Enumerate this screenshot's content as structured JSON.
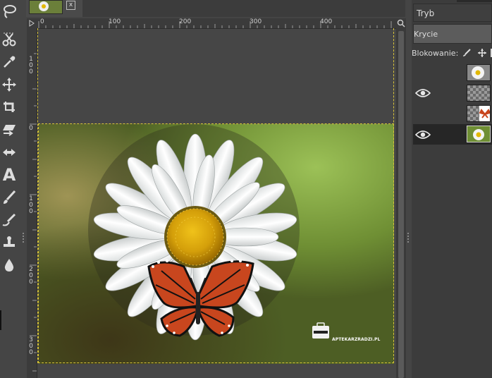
{
  "toolbox": {
    "tools": [
      {
        "name": "free-select",
        "icon": "lasso-icon"
      },
      {
        "name": "scissors-select",
        "icon": "scissors-icon"
      },
      {
        "name": "color-picker",
        "icon": "eyedropper-icon"
      },
      {
        "name": "move",
        "icon": "move-icon"
      },
      {
        "name": "crop",
        "icon": "crop-icon"
      },
      {
        "name": "shear",
        "icon": "shear-icon"
      },
      {
        "name": "flip",
        "icon": "flip-icon"
      },
      {
        "name": "text",
        "icon": "text-icon",
        "glyph": "A"
      },
      {
        "name": "paintbrush",
        "icon": "paintbrush-icon"
      },
      {
        "name": "smudge",
        "icon": "smudge-icon"
      },
      {
        "name": "clone",
        "icon": "clone-stamp-icon"
      },
      {
        "name": "blur",
        "icon": "drop-icon"
      }
    ]
  },
  "tabs": {
    "close_label": "x"
  },
  "rulers": {
    "horizontal": [
      "0",
      "100",
      "200",
      "300",
      "400"
    ],
    "vertical": [
      "1 0 0",
      "0",
      "1 0 0",
      "2 0 0",
      "3 0 0"
    ]
  },
  "canvas": {
    "watermark": "APTEKARZRADZI.PL"
  },
  "layers_panel": {
    "mode_label": "Tryb",
    "opacity_label": "Krycie",
    "lock_label": "Blokowanie:",
    "layers": [
      {
        "visible": false,
        "thumb": "daisy-cutout"
      },
      {
        "visible": true,
        "thumb": "transparent-butterfly-shadow"
      },
      {
        "visible": false,
        "thumb": "butterfly"
      },
      {
        "visible": true,
        "thumb": "daisy-background",
        "selected": true
      }
    ]
  },
  "colors": {
    "selection_border": "#d8c43a",
    "panel_bg": "#3c3c3c",
    "butterfly_orange": "#c8461e"
  }
}
